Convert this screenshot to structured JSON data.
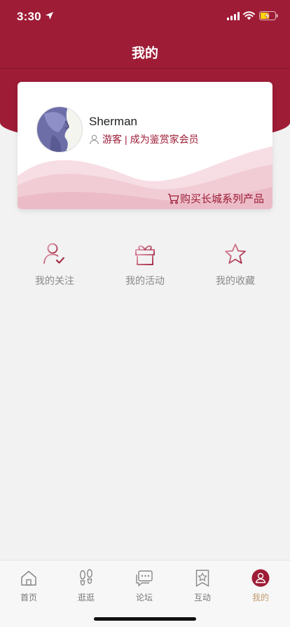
{
  "status_bar": {
    "time": "3:30"
  },
  "header": {
    "title": "我的"
  },
  "profile": {
    "username": "Sherman",
    "role": "游客",
    "separator": "|",
    "upgrade_link": "成为鉴赏家会员",
    "buy_link": "购买长城系列产品"
  },
  "actions": [
    {
      "label": "我的关注",
      "icon": "user-check-icon"
    },
    {
      "label": "我的活动",
      "icon": "gift-icon"
    },
    {
      "label": "我的收藏",
      "icon": "star-icon"
    }
  ],
  "tabs": [
    {
      "label": "首页",
      "icon": "home-icon"
    },
    {
      "label": "逛逛",
      "icon": "footprints-icon"
    },
    {
      "label": "论坛",
      "icon": "chat-icon"
    },
    {
      "label": "互动",
      "icon": "bookmark-star-icon"
    },
    {
      "label": "我的",
      "icon": "profile-icon",
      "active": true
    }
  ],
  "colors": {
    "brand": "#9e1c36",
    "active_tab": "#c19b6c",
    "background": "#f2f2f2"
  }
}
